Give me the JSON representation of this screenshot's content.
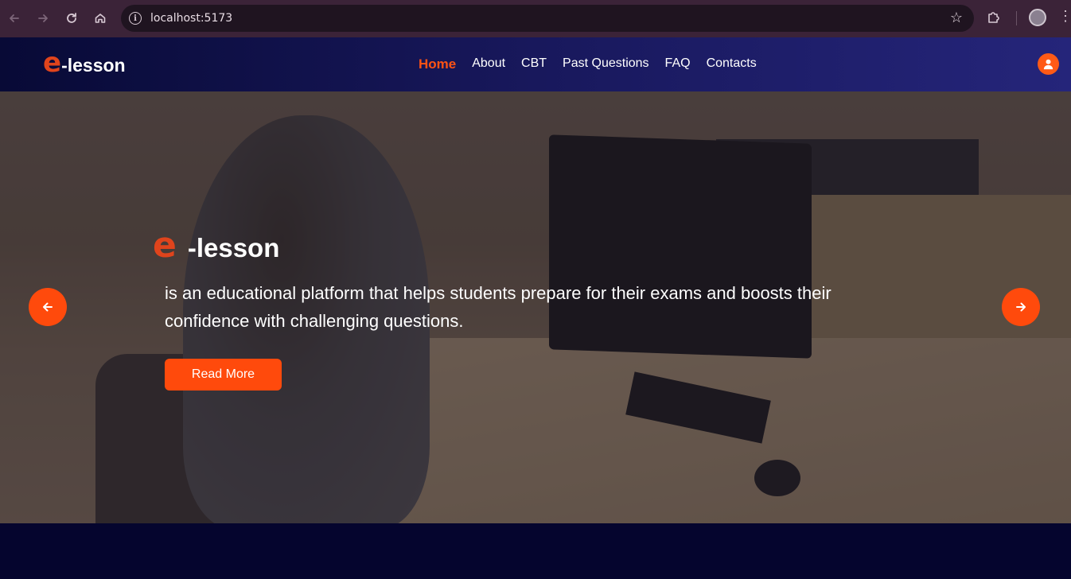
{
  "browser": {
    "url": "localhost:5173",
    "icons": [
      "back-icon",
      "forward-icon",
      "reload-icon",
      "home-icon",
      "info-icon",
      "star-icon",
      "extensions-icon",
      "profile-icon",
      "menu-icon"
    ]
  },
  "navbar": {
    "logo_e": "e",
    "logo_rest": "-lesson",
    "menu": [
      {
        "label": "Home",
        "active": true
      },
      {
        "label": "About",
        "active": false
      },
      {
        "label": "CBT",
        "active": false
      },
      {
        "label": "Past Questions",
        "active": false
      },
      {
        "label": "FAQ",
        "active": false
      },
      {
        "label": "Contacts",
        "active": false
      }
    ],
    "accent": "#ff5314"
  },
  "hero": {
    "brand_e": "e",
    "brand_rest": "-lesson",
    "description": "is an educational platform that helps students prepare for their exams and boosts their confidence with challenging questions.",
    "button_label": "Read More",
    "button_color": "#ff4a0c"
  }
}
